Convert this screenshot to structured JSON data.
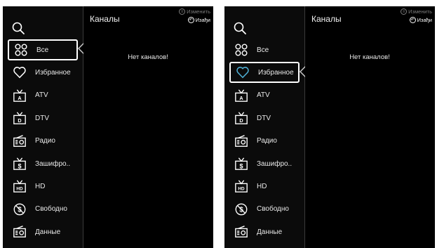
{
  "screens": [
    {
      "title": "Каналы",
      "edit_label": "Изменить",
      "back_label": "Изађи",
      "empty_message": "Нет каналов!",
      "selected_index": 0,
      "categories": [
        {
          "label": "Все",
          "icon": "grid-icon"
        },
        {
          "label": "Избранное",
          "icon": "heart-icon"
        },
        {
          "label": "ATV",
          "icon": "atv-icon"
        },
        {
          "label": "DTV",
          "icon": "dtv-icon"
        },
        {
          "label": "Радио",
          "icon": "radio-icon"
        },
        {
          "label": "Зашифро..",
          "icon": "scrambled-icon"
        },
        {
          "label": "HD",
          "icon": "hd-icon"
        },
        {
          "label": "Свободно",
          "icon": "free-icon"
        },
        {
          "label": "Данные",
          "icon": "data-icon"
        }
      ]
    },
    {
      "title": "Каналы",
      "edit_label": "Изменить",
      "back_label": "Изађи",
      "empty_message": "Нет каналов!",
      "selected_index": 1,
      "categories": [
        {
          "label": "Все",
          "icon": "grid-icon"
        },
        {
          "label": "Избранное",
          "icon": "heart-icon"
        },
        {
          "label": "ATV",
          "icon": "atv-icon"
        },
        {
          "label": "DTV",
          "icon": "dtv-icon"
        },
        {
          "label": "Радио",
          "icon": "radio-icon"
        },
        {
          "label": "Зашифро..",
          "icon": "scrambled-icon"
        },
        {
          "label": "HD",
          "icon": "hd-icon"
        },
        {
          "label": "Свободно",
          "icon": "free-icon"
        },
        {
          "label": "Данные",
          "icon": "data-icon"
        }
      ]
    }
  ],
  "colors": {
    "background": "#000000",
    "selected_heart": "#4fb0d6",
    "text": "#e8e8e8"
  }
}
